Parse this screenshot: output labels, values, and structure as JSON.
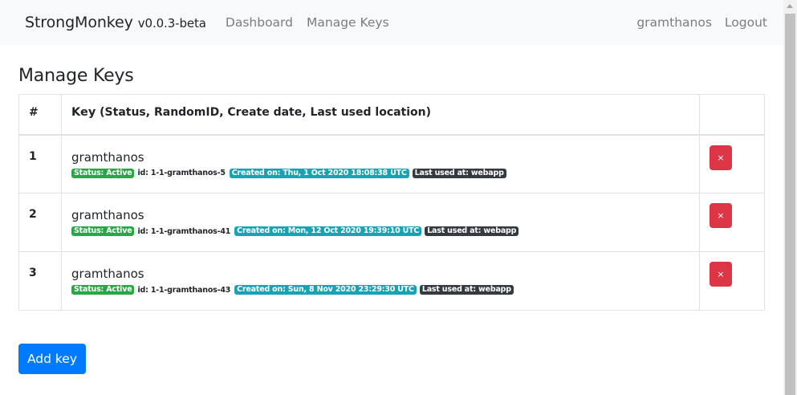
{
  "navbar": {
    "brand": "StrongMonkey",
    "version": "v0.0.3-beta",
    "links": [
      "Dashboard",
      "Manage Keys"
    ],
    "user": "gramthanos",
    "logout": "Logout"
  },
  "page": {
    "title": "Manage Keys"
  },
  "table": {
    "headers": {
      "num": "#",
      "key": "Key",
      "key_sub": "(Status, RandomID, Create date, Last used location)"
    },
    "rows": [
      {
        "num": "1",
        "name": "gramthanos",
        "status": "Status: Active",
        "id": "id: 1-1-gramthanos-5",
        "created": "Created on: Thu, 1 Oct 2020 18:08:38 UTC",
        "last_used": "Last used at: webapp",
        "delete": "×"
      },
      {
        "num": "2",
        "name": "gramthanos",
        "status": "Status: Active",
        "id": "id: 1-1-gramthanos-41",
        "created": "Created on: Mon, 12 Oct 2020 19:39:10 UTC",
        "last_used": "Last used at: webapp",
        "delete": "×"
      },
      {
        "num": "3",
        "name": "gramthanos",
        "status": "Status: Active",
        "id": "id: 1-1-gramthanos-43",
        "created": "Created on: Sun, 8 Nov 2020 23:29:30 UTC",
        "last_used": "Last used at: webapp",
        "delete": "×"
      }
    ]
  },
  "actions": {
    "add_key": "Add key"
  },
  "colors": {
    "navbar_bg": "#f8f9fa",
    "danger": "#dc3545",
    "primary": "#007bff",
    "success": "#28a745",
    "info": "#17a2b8",
    "dark": "#343a40"
  }
}
